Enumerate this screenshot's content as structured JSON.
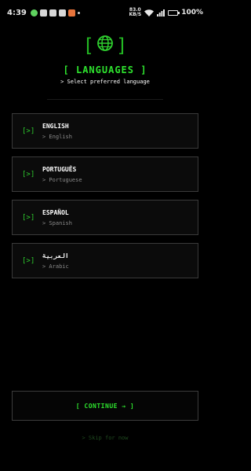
{
  "status_bar": {
    "time": "4:39",
    "net_speed_value": "83.0",
    "net_speed_unit": "KB/S",
    "battery": "100%"
  },
  "header": {
    "globe_icon": "globe-icon",
    "bracket_left": "[",
    "bracket_right": "]",
    "title": "[ LANGUAGES ]",
    "subtitle": "> Select preferred language"
  },
  "languages": [
    {
      "arrow": "[>]",
      "name": "ENGLISH",
      "subtitle": "> English"
    },
    {
      "arrow": "[>]",
      "name": "PORTUGUÊS",
      "subtitle": "> Portuguese"
    },
    {
      "arrow": "[>]",
      "name": "ESPAÑOL",
      "subtitle": "> Spanish"
    },
    {
      "arrow": "[>]",
      "name": "العربية",
      "subtitle": "> Arabic"
    }
  ],
  "actions": {
    "continue_label": "[ CONTINUE → ]",
    "skip_label": "> Skip for now"
  },
  "colors": {
    "accent": "#2ee32e",
    "background": "#000000",
    "card_border": "#3a3a3a"
  }
}
